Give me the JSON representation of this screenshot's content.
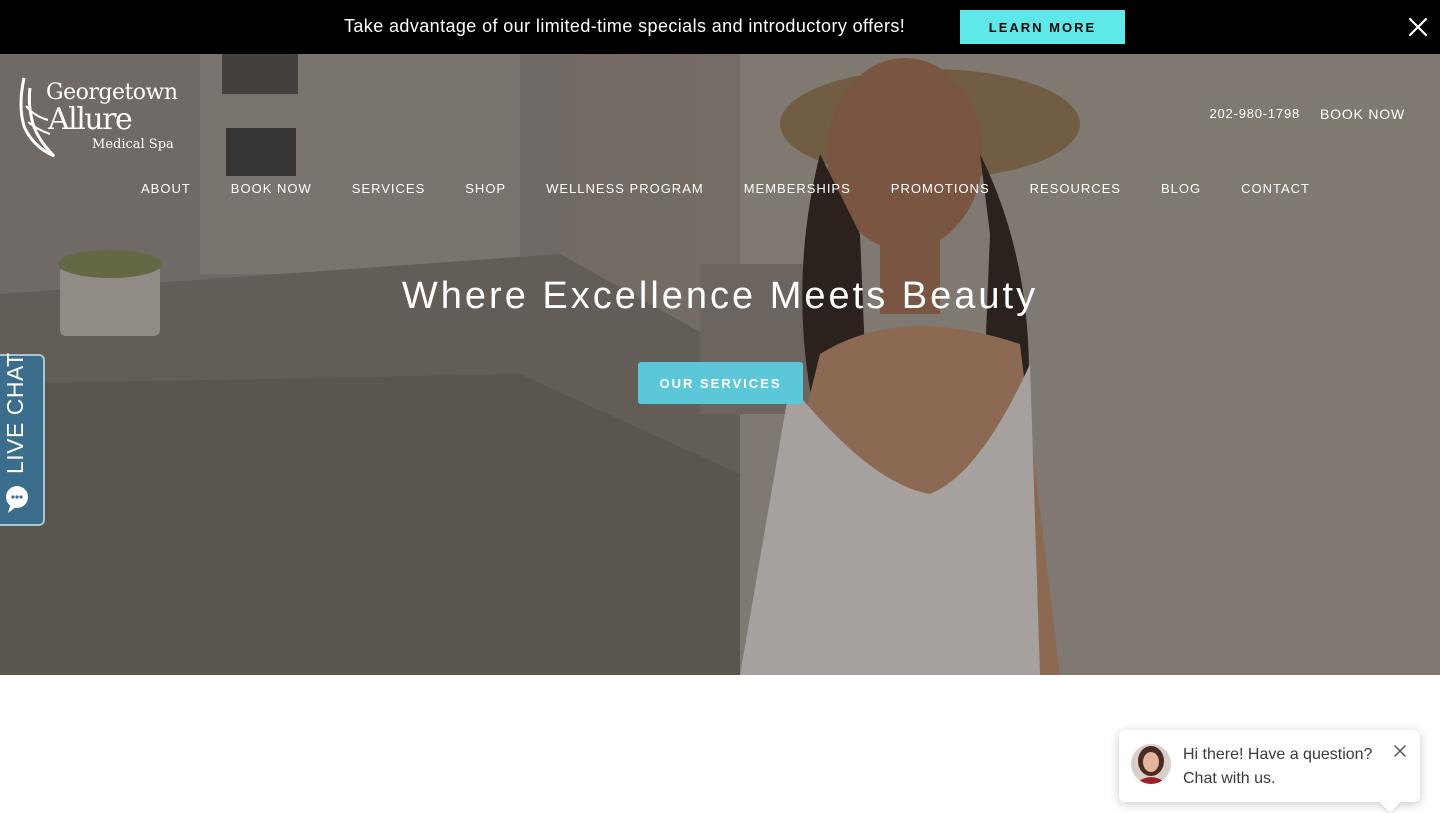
{
  "promo": {
    "text": "Take advantage of our limited-time specials and introductory offers!",
    "button_label": "LEARN MORE",
    "close_icon": "close-icon",
    "accent_color": "#5fe8e8"
  },
  "logo": {
    "line1": "Georgetown",
    "line2": "Allure",
    "line3": "Medical Spa",
    "icon": "feather-icon"
  },
  "header": {
    "phone": "202-980-1798",
    "book_now": "BOOK NOW"
  },
  "nav": {
    "items": [
      {
        "label": "ABOUT"
      },
      {
        "label": "BOOK NOW"
      },
      {
        "label": "SERVICES"
      },
      {
        "label": "SHOP"
      },
      {
        "label": "WELLNESS PROGRAM"
      },
      {
        "label": "MEMBERSHIPS"
      },
      {
        "label": "PROMOTIONS"
      },
      {
        "label": "RESOURCES"
      },
      {
        "label": "BLOG"
      },
      {
        "label": "CONTACT"
      }
    ]
  },
  "hero": {
    "title": "Where Excellence Meets Beauty",
    "cta_label": "OUR SERVICES",
    "cta_color": "#5cc7d9"
  },
  "live_chat": {
    "label": "LIVE CHAT",
    "icon": "chat-bubble-icon",
    "color": "#3b6e8d"
  },
  "chat_popup": {
    "line1": "Hi there! Have a question?",
    "line2": "Chat with us.",
    "avatar_icon": "agent-avatar",
    "close_icon": "close-icon"
  }
}
